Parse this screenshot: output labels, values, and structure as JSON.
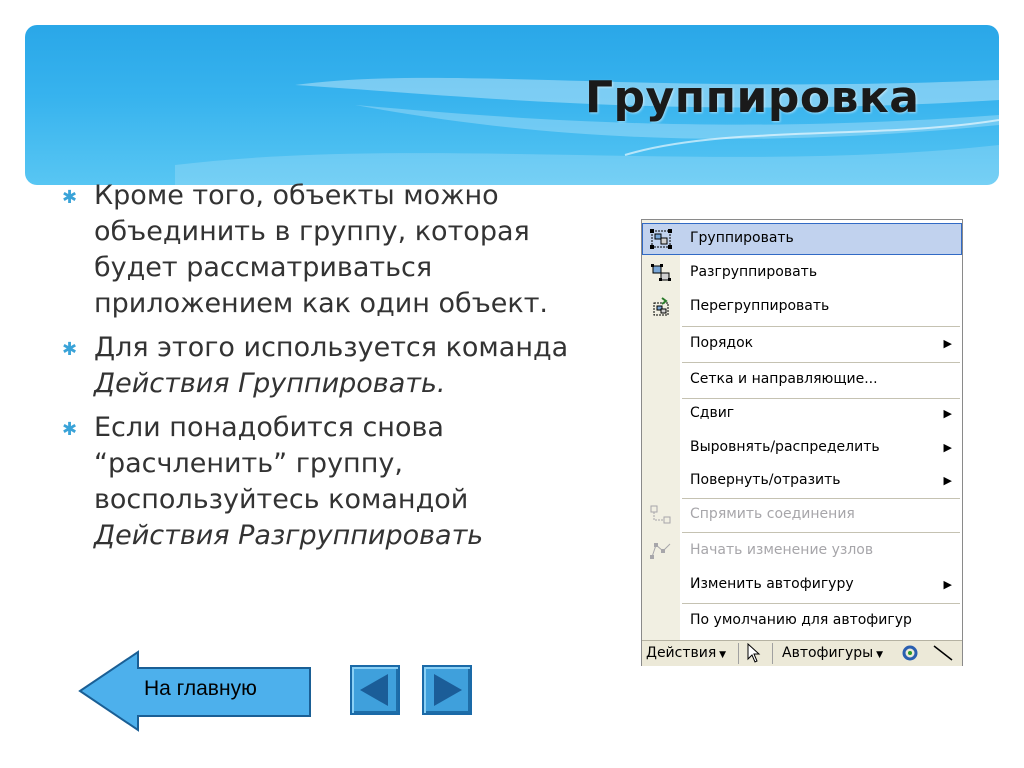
{
  "slide": {
    "title": "Группировка",
    "bullets": [
      {
        "text": "Кроме того, объекты можно объединить в группу, которая будет рассматриваться приложением как один объект.",
        "italic": ""
      },
      {
        "text": "Для этого используется команда",
        "italic": "Действия Группировать."
      },
      {
        "text": "Если понадобится снова “расчленить” группу, воспользуйтесь командой",
        "italic": "Действия Разгруппировать"
      }
    ]
  },
  "menu": {
    "items": [
      {
        "label": "Группировать",
        "icon": "group-icon",
        "selected": true,
        "disabled": false,
        "submenu": false
      },
      {
        "label": "Разгруппировать",
        "icon": "ungroup-icon",
        "selected": false,
        "disabled": false,
        "submenu": false
      },
      {
        "label": "Перегруппировать",
        "icon": "regroup-icon",
        "selected": false,
        "disabled": false,
        "submenu": false
      },
      {
        "label": "Порядок",
        "icon": "",
        "selected": false,
        "disabled": false,
        "submenu": true
      },
      {
        "label": "Сетка и направляющие...",
        "icon": "",
        "selected": false,
        "disabled": false,
        "submenu": false
      },
      {
        "label": "Сдвиг",
        "icon": "",
        "selected": false,
        "disabled": false,
        "submenu": true
      },
      {
        "label": "Выровнять/распределить",
        "icon": "",
        "selected": false,
        "disabled": false,
        "submenu": true
      },
      {
        "label": "Повернуть/отразить",
        "icon": "",
        "selected": false,
        "disabled": false,
        "submenu": true
      },
      {
        "label": "Спрямить соединения",
        "icon": "reroute-connectors-icon",
        "selected": false,
        "disabled": true,
        "submenu": false
      },
      {
        "label": "Начать изменение узлов",
        "icon": "edit-points-icon",
        "selected": false,
        "disabled": true,
        "submenu": false
      },
      {
        "label": "Изменить автофигуру",
        "icon": "",
        "selected": false,
        "disabled": false,
        "submenu": true
      },
      {
        "label": "По умолчанию для автофигур",
        "icon": "",
        "selected": false,
        "disabled": false,
        "submenu": false
      }
    ],
    "toolbar": {
      "actions_label": "Действия",
      "autoshapes_label": "Автофигуры"
    }
  },
  "nav": {
    "home_label": "На главную",
    "prev_icon": "left-arrow-icon",
    "next_icon": "right-arrow-icon"
  },
  "colors": {
    "banner": "#37b3ee",
    "nav_button": "#3fa0dc",
    "home_arrow": "#4db0ec",
    "menu_highlight": "#c1d2ee"
  }
}
